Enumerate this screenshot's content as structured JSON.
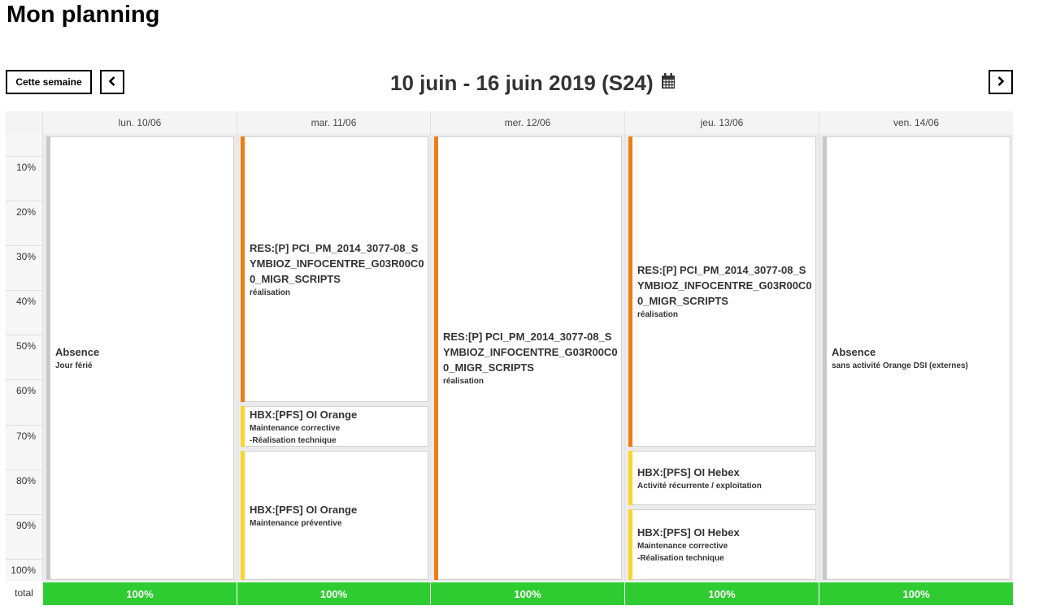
{
  "page": {
    "title": "Mon planning"
  },
  "toolbar": {
    "this_week_label": "Cette semaine",
    "prev_icon": "chevron-left-icon",
    "next_icon": "chevron-right-icon",
    "week_title": "10 juin - 16 juin 2019 (S24)",
    "calendar_icon": "calendar-icon"
  },
  "calendar": {
    "days": [
      {
        "label": "lun. 10/06"
      },
      {
        "label": "mar. 11/06"
      },
      {
        "label": "mer. 12/06"
      },
      {
        "label": "jeu. 13/06"
      },
      {
        "label": "ven. 14/06"
      }
    ],
    "percent_labels": [
      "10%",
      "20%",
      "30%",
      "40%",
      "50%",
      "60%",
      "70%",
      "80%",
      "90%",
      "100%"
    ],
    "total_label": "total",
    "totals": [
      "100%",
      "100%",
      "100%",
      "100%",
      "100%"
    ],
    "events": [
      {
        "title": "Absence",
        "subtitle": "Jour férié",
        "color": "#c8c8c8"
      },
      {
        "title": "RES:[P] PCI_PM_2014_3077-08_SYMBIOZ_INFOCENTRE_G03R00C00_MIGR_SCRIPTS",
        "subtitle": "réalisation",
        "color": "#f07d12"
      },
      {
        "title": "HBX:[PFS] OI Orange",
        "subtitle": "Maintenance corrective",
        "subtitle2": "-Réalisation technique",
        "color": "#f8d52a"
      },
      {
        "title": "HBX:[PFS] OI Orange",
        "subtitle": "Maintenance préventive",
        "color": "#f8d52a"
      },
      {
        "title": "RES:[P] PCI_PM_2014_3077-08_SYMBIOZ_INFOCENTRE_G03R00C00_MIGR_SCRIPTS",
        "subtitle": "réalisation",
        "color": "#f07d12"
      },
      {
        "title": "RES:[P] PCI_PM_2014_3077-08_SYMBIOZ_INFOCENTRE_G03R00C00_MIGR_SCRIPTS",
        "subtitle": "réalisation",
        "color": "#f07d12"
      },
      {
        "title": "HBX:[PFS] OI Hebex",
        "subtitle": "Activité récurrente / exploitation",
        "color": "#f8d52a"
      },
      {
        "title": "HBX:[PFS] OI Hebex",
        "subtitle": "Maintenance corrective",
        "subtitle2": "-Réalisation technique",
        "color": "#f8d52a"
      },
      {
        "title": "Absence",
        "subtitle": "sans activité Orange DSI (externes)",
        "color": "#c8c8c8"
      }
    ],
    "total_color": "#2ecc30"
  }
}
